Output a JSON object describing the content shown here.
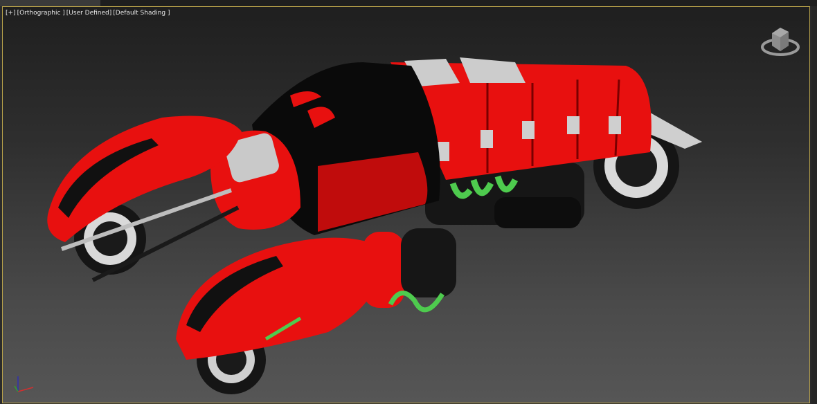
{
  "viewport": {
    "labels": [
      "[+]",
      "[Orthographic ]",
      "[User Defined]",
      "[Default Shading ]"
    ],
    "active_border_color": "#b8a24a",
    "view_cube_icon": "view-cube-icon",
    "axis_gizmo": {
      "x_color": "#d03030",
      "y_color": "#30a030",
      "z_label": "z"
    }
  },
  "model": {
    "primary_color": "#e8100f",
    "secondary_color": "#111111",
    "accent_color": "#4ecb4e"
  }
}
